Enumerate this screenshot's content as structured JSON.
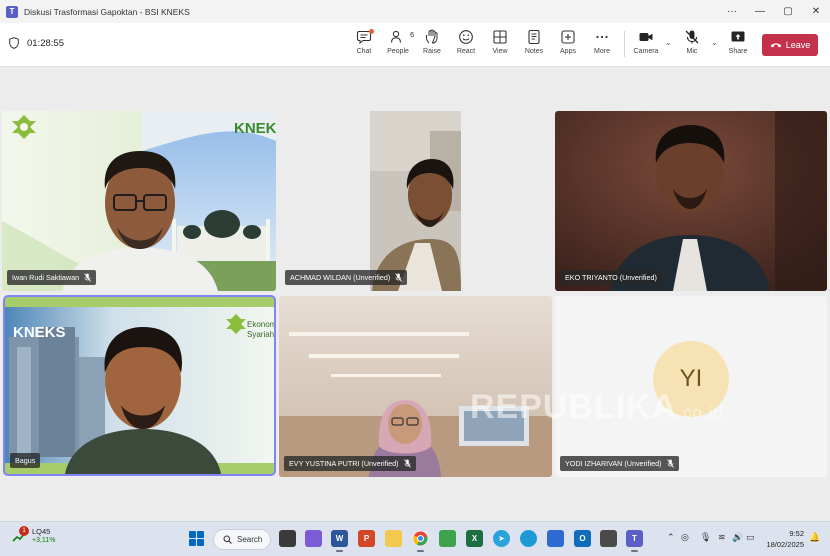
{
  "window": {
    "title": "Diskusi Trasformasi Gapoktan - BSI KNEKS",
    "controls": [
      "···",
      "—",
      "▢",
      "✕"
    ]
  },
  "toolbar": {
    "timer": "01:28:55",
    "chat_label": "Chat",
    "people_label": "People",
    "people_count": "6",
    "raise_label": "Raise",
    "react_label": "React",
    "view_label": "View",
    "notes_label": "Notes",
    "apps_label": "Apps",
    "more_label": "More",
    "camera_label": "Camera",
    "mic_label": "Mic",
    "share_label": "Share",
    "leave_label": "Leave"
  },
  "participants": [
    {
      "name": "Iwan Rudi Saktiawan",
      "background_logo": "KNEKS"
    },
    {
      "name": "ACHMAD WILDAN (Unverified)"
    },
    {
      "name": "EKO TRIYANTO (Unverified)"
    },
    {
      "name": "Bagus",
      "background_logo": "KNEKS",
      "background_badge_line1": "Ekonomi",
      "background_badge_line2": "Syariah",
      "active_speaker": true
    },
    {
      "name": "EVY YUSTINA PUTRI (Unverified)"
    },
    {
      "name": "YODI IZHARIVAN (Unverified)",
      "initials": "YI"
    }
  ],
  "watermark": {
    "brand": "REPUBLIKA",
    "suffix": ".co.id"
  },
  "taskbar": {
    "stock_badge": "1",
    "stock_name": "LQ45",
    "stock_change": "+3,11%",
    "search_label": "Search",
    "time": "9:52",
    "date": "18/02/2025"
  },
  "colors": {
    "accent": "#5b5fc7",
    "leave": "#c4314b",
    "active_outline": "#7f85f5"
  }
}
